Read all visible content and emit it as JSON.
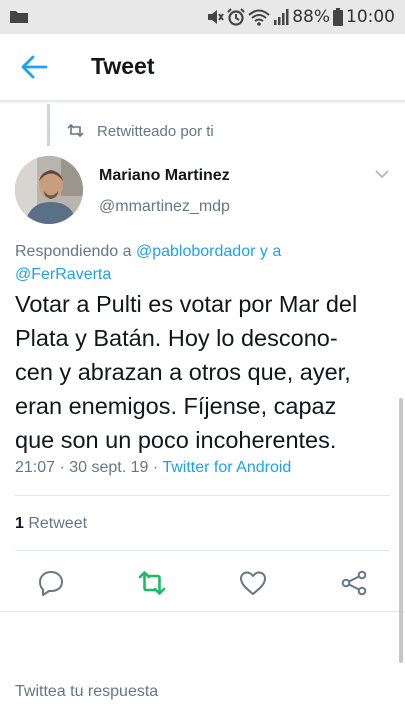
{
  "status_bar": {
    "battery": "88%",
    "time": "10:00",
    "icons": [
      "folder-icon",
      "mute-icon",
      "alarm-icon",
      "wifi-icon",
      "signal-icon",
      "battery-icon"
    ]
  },
  "header": {
    "title": "Tweet",
    "back_icon": "back-arrow-icon"
  },
  "retweet_context": {
    "label": "Retwitteado por ti",
    "icon": "retweet-icon"
  },
  "author": {
    "name": "Mariano Martinez",
    "handle": "@mmartinez_mdp",
    "avatar_icon": "avatar"
  },
  "reply_context": {
    "prefix": "Respondiendo a ",
    "mention1": "@pablobordador",
    "joiner": " y a ",
    "mention2": "@FerRaverta"
  },
  "tweet": {
    "text": "Votar a Pulti es votar por Mar del\nPlata y Batán. Hoy lo descono-\ncen y abrazan a otros que, ayer,\neran enemigos. Fíjense, capaz\nque son un poco incoherentes.",
    "time": "21:07 · 30 sept. 19 · ",
    "source": "Twitter for Android"
  },
  "stats": {
    "retweet_count": "1",
    "retweet_label": " Retweet"
  },
  "actions": [
    "reply-icon",
    "retweet-icon",
    "like-icon",
    "share-icon"
  ],
  "colors": {
    "accent": "#1da1f2",
    "retweeted": "#17bf63",
    "muted": "#657786",
    "text": "#14171a",
    "divider": "#e1e8ed"
  },
  "reply_box": {
    "placeholder": "Twittea tu respuesta"
  }
}
